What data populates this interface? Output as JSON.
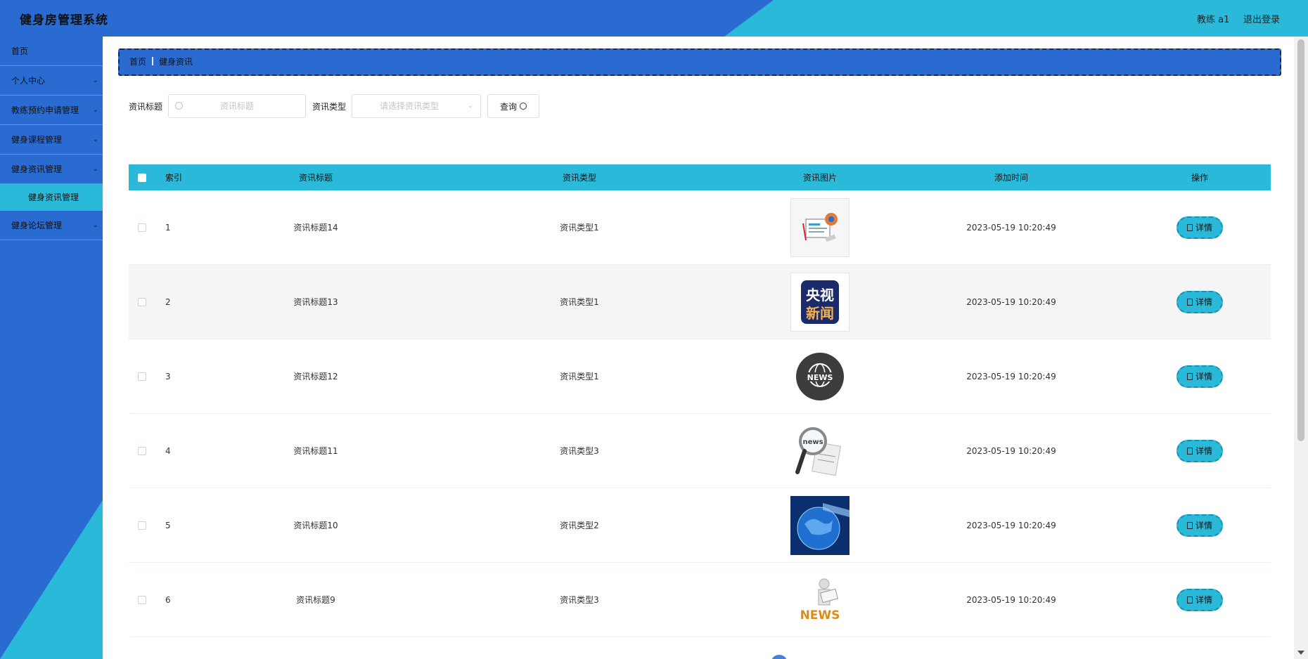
{
  "app": {
    "title": "健身房管理系统",
    "user": "教练 a1",
    "logout": "退出登录"
  },
  "sidebar": {
    "items": [
      {
        "label": "首页",
        "chevron": false
      },
      {
        "label": "个人中心",
        "chevron": true
      },
      {
        "label": "教练预约申请管理",
        "chevron": true
      },
      {
        "label": "健身课程管理",
        "chevron": true
      },
      {
        "label": "健身资讯管理",
        "chevron": true
      }
    ],
    "active_sub": "健身资讯管理",
    "last_item": "健身论坛管理"
  },
  "breadcrumb": {
    "home": "首页",
    "current": "健身资讯"
  },
  "search": {
    "title_label": "资讯标题",
    "title_placeholder": "资讯标题",
    "type_label": "资讯类型",
    "type_placeholder": "请选择资讯类型",
    "query_label": "查询"
  },
  "table": {
    "headers": {
      "index": "索引",
      "title": "资讯标题",
      "type": "资讯类型",
      "image": "资讯图片",
      "time": "添加时间",
      "action": "操作"
    },
    "detail_label": "详情",
    "rows": [
      {
        "index": "1",
        "title": "资讯标题14",
        "type": "资讯类型1",
        "time": "2023-05-19 10:20:49",
        "image": "news-clipart"
      },
      {
        "index": "2",
        "title": "资讯标题13",
        "type": "资讯类型1",
        "time": "2023-05-19 10:20:49",
        "image": "cctv-news-logo",
        "logo_text": "央视新闻"
      },
      {
        "index": "3",
        "title": "资讯标题12",
        "type": "资讯类型1",
        "time": "2023-05-19 10:20:49",
        "image": "news-globe-badge",
        "badge_text": "NEWS"
      },
      {
        "index": "4",
        "title": "资讯标题11",
        "type": "资讯类型3",
        "time": "2023-05-19 10:20:49",
        "image": "magnifier-newspaper",
        "badge_text": "news"
      },
      {
        "index": "5",
        "title": "资讯标题10",
        "type": "资讯类型2",
        "time": "2023-05-19 10:20:49",
        "image": "blue-globe"
      },
      {
        "index": "6",
        "title": "资讯标题9",
        "type": "资讯类型3",
        "time": "2023-05-19 10:20:49",
        "image": "news-3d-figure",
        "badge_text": "NEWS"
      }
    ]
  },
  "colors": {
    "blue": "#2a6bd1",
    "teal": "#2ab9d9"
  }
}
